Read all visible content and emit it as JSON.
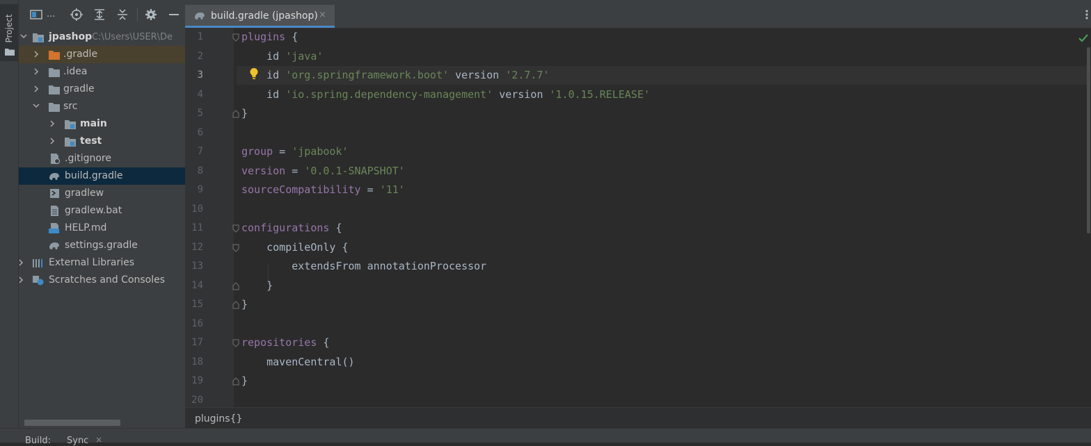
{
  "left_stripe": {
    "project_tab_label": "Project"
  },
  "project_panel": {
    "view_label": "...",
    "tree": [
      {
        "label": "jpashop",
        "path": "C:\\Users\\USER\\De"
      },
      {
        "label": ".gradle"
      },
      {
        "label": ".idea"
      },
      {
        "label": "gradle"
      },
      {
        "label": "src"
      },
      {
        "label": "main"
      },
      {
        "label": "test"
      },
      {
        "label": ".gitignore"
      },
      {
        "label": "build.gradle"
      },
      {
        "label": "gradlew"
      },
      {
        "label": "gradlew.bat"
      },
      {
        "label": "HELP.md"
      },
      {
        "label": "settings.gradle"
      },
      {
        "label": "External Libraries"
      },
      {
        "label": "Scratches and Consoles"
      }
    ]
  },
  "editor": {
    "tab_label": "build.gradle (jpashop)",
    "tab_close": "×",
    "line_numbers": [
      "1",
      "2",
      "3",
      "4",
      "5",
      "6",
      "7",
      "8",
      "9",
      "10",
      "11",
      "12",
      "13",
      "14",
      "15",
      "16",
      "17",
      "18",
      "19",
      "20"
    ],
    "current_line": "3",
    "code": {
      "l1": {
        "kw": "plugins",
        "rest": " {"
      },
      "l2": {
        "kw": "id",
        "str": "'java'"
      },
      "l3": {
        "kw": "id",
        "str": "'org.springframework.boot'",
        "kw2": "version",
        "str2": "'2.7.7'"
      },
      "l4": {
        "kw": "id",
        "str": "'io.spring.dependency-management'",
        "kw2": "version",
        "str2": "'1.0.15.RELEASE'"
      },
      "l5": "}",
      "l7": {
        "kw": "group",
        "op": " = ",
        "str": "'jpabook'"
      },
      "l8": {
        "kw": "version",
        "op": " = ",
        "str": "'0.0.1-SNAPSHOT'"
      },
      "l9": {
        "kw": "sourceCompatibility",
        "op": " = ",
        "str": "'11'"
      },
      "l11": {
        "kw": "configurations",
        "rest": " {"
      },
      "l12": {
        "kw": "compileOnly",
        "rest": " {"
      },
      "l13": "extendsFrom annotationProcessor",
      "l14": "}",
      "l15": "}",
      "l17": {
        "kw": "repositories",
        "rest": " {"
      },
      "l18": "mavenCentral()",
      "l19": "}"
    },
    "breadcrumb": "plugins{}"
  },
  "bottom": {
    "build_tab": "Build:",
    "sync_tab": "Sync",
    "sync_close": "×"
  },
  "colors": {
    "background": "#2b2b2b",
    "panel": "#3c3f41",
    "selection": "#0d293e",
    "tab_underline": "#4a88c7",
    "keyword": "#9876aa",
    "string": "#6a8759",
    "plain": "#a9b7c6"
  }
}
